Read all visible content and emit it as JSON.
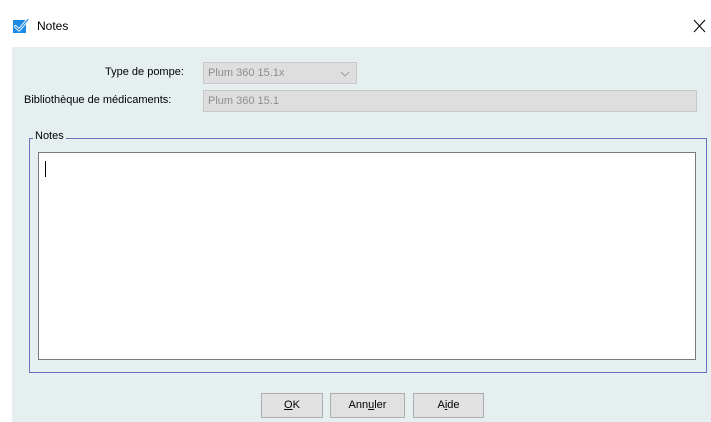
{
  "window": {
    "title": "Notes",
    "accent": "#1e88e5"
  },
  "form": {
    "pump_type_label": "Type de pompe:",
    "pump_type_value": "Plum 360 15.1x",
    "library_label": "Bibliothèque de médicaments:",
    "library_value": "Plum 360 15.1"
  },
  "notes": {
    "group_label": "Notes",
    "value": ""
  },
  "buttons": {
    "ok": {
      "before": "",
      "mnemonic": "O",
      "after": "K"
    },
    "cancel": {
      "before": "Ann",
      "mnemonic": "u",
      "after": "ler"
    },
    "help": {
      "before": "A",
      "mnemonic": "i",
      "after": "de"
    }
  }
}
